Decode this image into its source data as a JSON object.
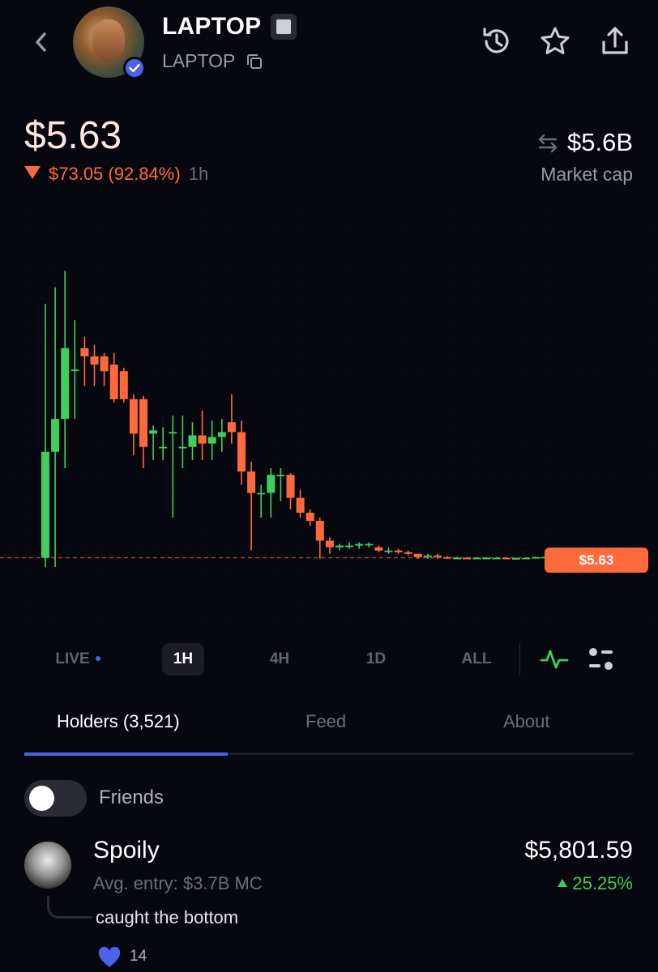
{
  "header": {
    "title": "LAPTOP",
    "ticker": "LAPTOP",
    "icons": [
      "back-icon",
      "history-icon",
      "star-icon",
      "share-icon",
      "copy-icon",
      "verified-icon"
    ]
  },
  "price": {
    "current": "$5.63",
    "change": "$73.05 (92.84%)",
    "period": "1h",
    "market_cap": "$5.6B",
    "market_cap_label": "Market cap"
  },
  "chart_data": {
    "type": "candlestick",
    "x": [
      1,
      2,
      3,
      4,
      5,
      6,
      7,
      8,
      9,
      10,
      11,
      12,
      13,
      14,
      15,
      16,
      17,
      18,
      19,
      20,
      21,
      22,
      23,
      24,
      25,
      26,
      27,
      28,
      29,
      30,
      31,
      32,
      33,
      34,
      35,
      36,
      37,
      38,
      39,
      40,
      41,
      42,
      43,
      44,
      45,
      46,
      47,
      48,
      49,
      50,
      51,
      52,
      53
    ],
    "series": [
      {
        "open": [
          5.6,
          70,
          90,
          120,
          133,
          128,
          128,
          123,
          119,
          102,
          102,
          81,
          73,
          82,
          73,
          73,
          80,
          75,
          79,
          88,
          82,
          58,
          45,
          45,
          56,
          56,
          42,
          33,
          28,
          16,
          12,
          13,
          13,
          14,
          12,
          10,
          10,
          9,
          8,
          6,
          7,
          6,
          5.6,
          5.6,
          5.5,
          5.6,
          5.6,
          5.6,
          5.4,
          5.4,
          5.6,
          6.0,
          6.2
        ],
        "close": [
          70,
          90,
          133,
          120,
          128,
          123,
          119,
          102,
          102,
          81,
          73,
          83,
          73,
          82,
          73,
          80,
          75,
          79,
          82,
          82,
          58,
          45,
          45,
          56,
          56,
          42,
          33,
          28,
          16,
          12,
          13,
          13,
          14,
          14,
          10,
          10,
          9,
          8,
          6,
          7,
          6,
          5.6,
          5.6,
          5.5,
          5.6,
          5.6,
          5.6,
          5.4,
          5.4,
          5.6,
          6.0,
          6.2,
          5.63
        ],
        "high": [
          160,
          170,
          180,
          150,
          140,
          135,
          130,
          130,
          121,
          105,
          104,
          86,
          85,
          92,
          92,
          88,
          95,
          89,
          90,
          105,
          89,
          64,
          50,
          60,
          60,
          57,
          47,
          35,
          30,
          18,
          14,
          15,
          15,
          15,
          13,
          12,
          11,
          10,
          8,
          8,
          8,
          6.5,
          6.2,
          6.0,
          6.0,
          6.0,
          6.0,
          6.0,
          5.8,
          5.8,
          6.2,
          6.4,
          6.4
        ],
        "low": [
          0,
          0,
          60,
          90,
          110,
          110,
          110,
          100,
          100,
          68,
          60,
          65,
          65,
          30,
          60,
          65,
          65,
          65,
          70,
          75,
          50,
          10,
          30,
          30,
          40,
          35,
          30,
          25,
          5,
          8,
          10,
          11,
          11,
          12,
          9,
          8,
          8,
          7,
          5,
          5,
          5,
          5,
          5,
          5,
          5,
          5,
          5,
          5,
          5,
          5,
          5.5,
          5.8,
          5.5
        ]
      }
    ],
    "current_price_label": "$5.63",
    "grid": true
  },
  "timeframes": {
    "items": [
      "LIVE",
      "1H",
      "4H",
      "1D",
      "ALL"
    ],
    "active": "1H"
  },
  "tabs": {
    "items": [
      "Holders (3,521)",
      "Feed",
      "About"
    ],
    "active": "Holders (3,521)"
  },
  "friends_toggle": {
    "label": "Friends",
    "on": false
  },
  "holders": [
    {
      "name": "Spoily",
      "entry": "Avg. entry: $3.7B MC",
      "value": "$5,801.59",
      "pnl": "25.25%",
      "comment": "caught the bottom",
      "likes": "14"
    }
  ],
  "colors": {
    "background": "#07070f",
    "accent": "#4b63e6",
    "down": "#ff6a3d",
    "up": "#3ecf5b"
  }
}
